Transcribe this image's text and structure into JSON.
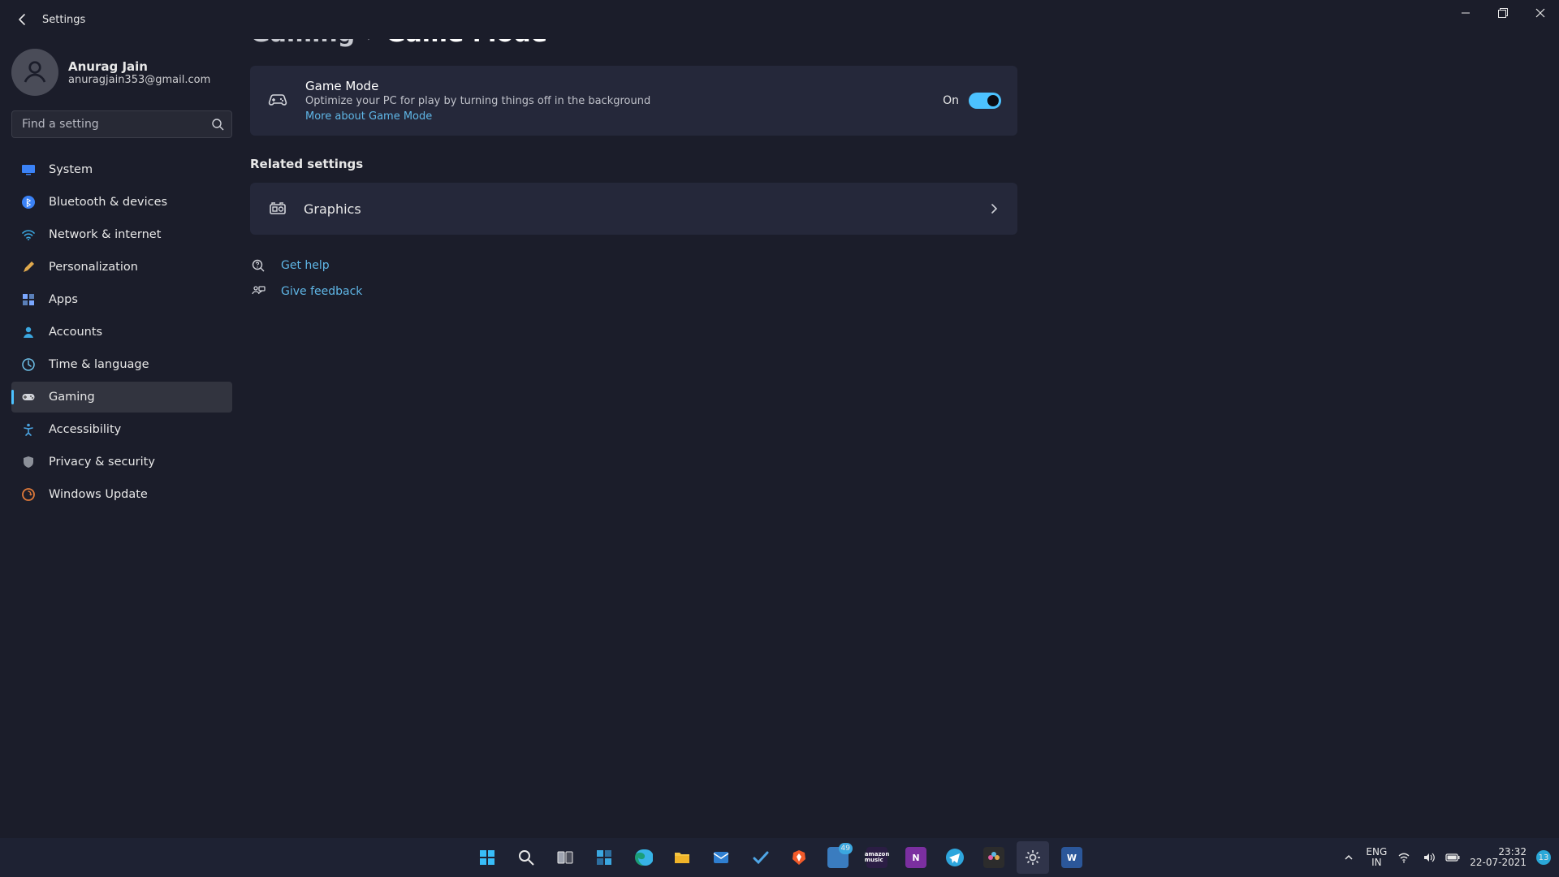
{
  "app_title": "Settings",
  "user": {
    "name": "Anurag Jain",
    "email": "anuragjain353@gmail.com"
  },
  "search": {
    "placeholder": "Find a setting"
  },
  "nav": [
    {
      "label": "System"
    },
    {
      "label": "Bluetooth & devices"
    },
    {
      "label": "Network & internet"
    },
    {
      "label": "Personalization"
    },
    {
      "label": "Apps"
    },
    {
      "label": "Accounts"
    },
    {
      "label": "Time & language"
    },
    {
      "label": "Gaming"
    },
    {
      "label": "Accessibility"
    },
    {
      "label": "Privacy & security"
    },
    {
      "label": "Windows Update"
    }
  ],
  "breadcrumb": {
    "parent": "Gaming",
    "separator": "›",
    "current": "Game Mode"
  },
  "game_mode_card": {
    "title": "Game Mode",
    "subtitle": "Optimize your PC for play by turning things off in the background",
    "link": "More about Game Mode",
    "state_label": "On"
  },
  "related": {
    "heading": "Related settings",
    "items": [
      {
        "label": "Graphics"
      }
    ]
  },
  "help": {
    "get_help": "Get help",
    "give_feedback": "Give feedback"
  },
  "taskbar": {
    "lang_top": "ENG",
    "lang_bottom": "IN",
    "time": "23:32",
    "date": "22-07-2021",
    "notification_count": "13",
    "pinned_badge": "49"
  },
  "colors": {
    "accent": "#4cc2ff",
    "link": "#5fb6e6",
    "card": "#25283a",
    "bg": "#1b1d2a"
  }
}
